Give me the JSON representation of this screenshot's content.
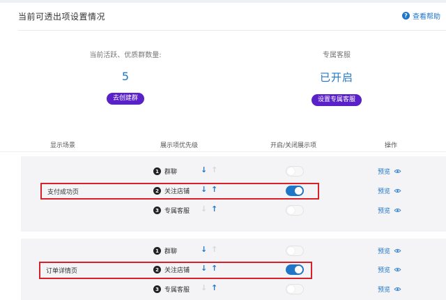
{
  "header": {
    "title": "当前可透出项设置情况",
    "help_label": "查看帮助",
    "help_icon": "?"
  },
  "stats": {
    "groups": {
      "label": "当前活跃、优质群数量:",
      "value": "5",
      "button": "去创建群"
    },
    "service": {
      "label": "专属客服",
      "value": "已开启",
      "button": "设置专属客服"
    }
  },
  "table": {
    "columns": [
      "显示场景",
      "展示项优先级",
      "开启/关闭展示项",
      "操作"
    ],
    "groups": [
      {
        "scene": "支付成功页",
        "rows": [
          {
            "num": "1",
            "label": "群聊",
            "toggle_on": false,
            "preview": "预览"
          },
          {
            "num": "2",
            "label": "关注店铺",
            "toggle_on": true,
            "preview": "预览"
          },
          {
            "num": "3",
            "label": "专属客服",
            "toggle_on": false,
            "preview": "预览"
          }
        ]
      },
      {
        "scene": "订单详情页",
        "rows": [
          {
            "num": "1",
            "label": "群聊",
            "toggle_on": false,
            "preview": "预览"
          },
          {
            "num": "2",
            "label": "关注店铺",
            "toggle_on": true,
            "preview": "预览"
          },
          {
            "num": "3",
            "label": "专属客服",
            "toggle_on": false,
            "preview": "预览"
          }
        ]
      }
    ]
  },
  "arrows": {
    "down": "↓",
    "up": "↑"
  },
  "colors": {
    "accent": "#1f76c8",
    "button": "#5b21c9",
    "highlight": "#d8202b"
  }
}
